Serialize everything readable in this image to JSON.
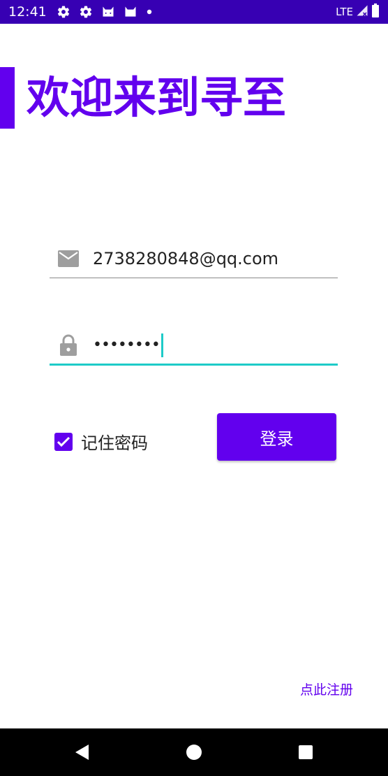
{
  "status_bar": {
    "time": "12:41",
    "network": "LTE",
    "left_icons": [
      "gear-icon",
      "gear-icon",
      "android-cat-icon",
      "android-cat-icon",
      "dot-icon"
    ],
    "right_icons": [
      "signal-icon",
      "battery-icon"
    ]
  },
  "colors": {
    "accent": "#6200EE",
    "status_bar": "#3700B3",
    "focus_underline": "#1ECBC8"
  },
  "header": {
    "title": "欢迎来到寻至"
  },
  "form": {
    "email": {
      "value": "2738280848@qq.com",
      "icon": "mail-icon"
    },
    "password": {
      "value": "••••••••",
      "icon": "lock-icon",
      "focused": true
    },
    "remember": {
      "label": "记住密码",
      "checked": true
    },
    "login_label": "登录",
    "register_link": "点此注册"
  },
  "nav": {
    "icons": [
      "back-icon",
      "home-icon",
      "recents-icon"
    ]
  }
}
